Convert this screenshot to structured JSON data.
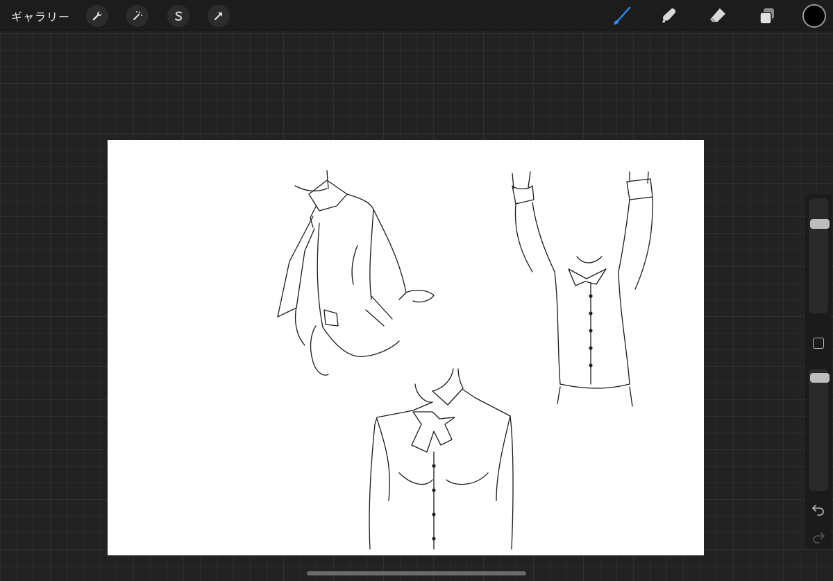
{
  "toolbar": {
    "gallery_label": "ギャラリー",
    "left_tools": [
      "wrench-icon",
      "magic-wand-icon",
      "selection-s-icon",
      "transform-arrow-icon"
    ],
    "right_tools": [
      "brush-icon",
      "smudge-icon",
      "eraser-icon",
      "layers-icon"
    ],
    "active_tool": "brush",
    "active_color": "#000000",
    "accent_color": "#2f8cff"
  },
  "sidebar": {
    "brush_size_level": 0.2,
    "opacity_level": 0.04,
    "icons": [
      "modify-square-icon",
      "undo-icon",
      "redo-icon"
    ]
  }
}
